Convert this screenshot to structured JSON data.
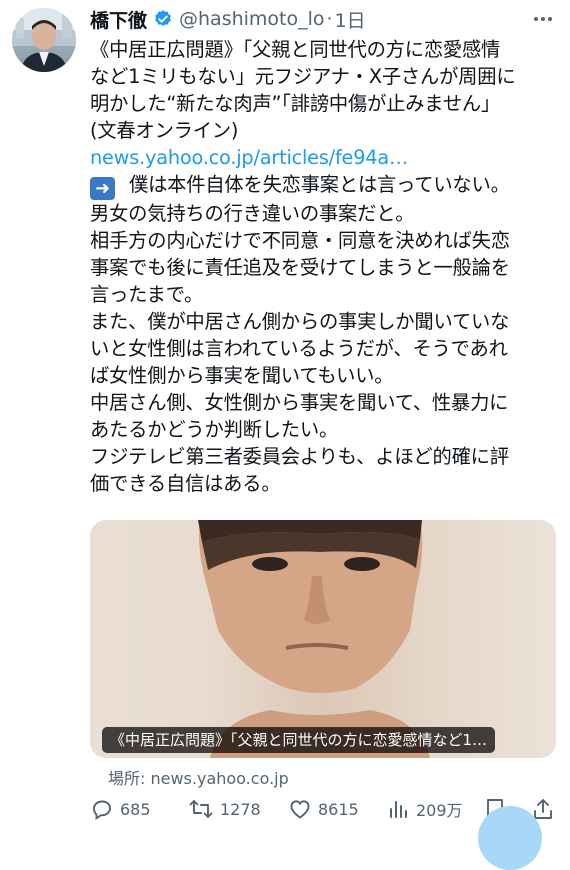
{
  "tweet": {
    "author_name": "橋下徹",
    "handle": "@hashimoto_lo",
    "separator": "·",
    "time": "1日",
    "lines": [
      "《中居正広問題》「父親と同世代の方に恋愛感情",
      "など1ミリもない」元フジアナ・X子さんが周囲に",
      "明かした“新たな肉声”「誹謗中傷が止みません」",
      "(文春オンライン)"
    ],
    "link": "news.yahoo.co.jp/articles/fe94a…",
    "arrow_emoji": "➡️",
    "body_lines": [
      "僕は本件自体を失恋事案とは言っていない。",
      "男女の気持ちの行き違いの事案だと。",
      "相手方の内心だけで不同意・同意を決めれば失恋",
      "事案でも後に責任追及を受けてしまうと一般論を",
      "言ったまで。",
      "また、僕が中居さん側からの事実しか聞いていな",
      "いと女性側は言われているようだが、そうであれ",
      "ば女性側から事実を聞いてもいい。",
      "中居さん側、女性側から事実を聞いて、性暴力に",
      "あたるかどうか判断したい。",
      "フジテレビ第三者委員会よりも、よほど的確に評",
      "価できる自信はある。"
    ]
  },
  "card": {
    "caption": "《中居正広問題》「父親と同世代の方に恋愛感情など1…",
    "source_label": "場所: news.yahoo.co.jp"
  },
  "actions": {
    "replies": "685",
    "retweets": "1278",
    "likes": "8615",
    "views": "209万"
  },
  "colors": {
    "accent": "#1d9bf0",
    "secondary_text": "#536471",
    "verified_badge": "#1d9bf0"
  },
  "icons": [
    "verified-badge-icon",
    "more-icon",
    "reply-icon",
    "retweet-icon",
    "like-icon",
    "views-icon",
    "bookmark-icon",
    "share-icon",
    "arrow-emoji-icon"
  ]
}
